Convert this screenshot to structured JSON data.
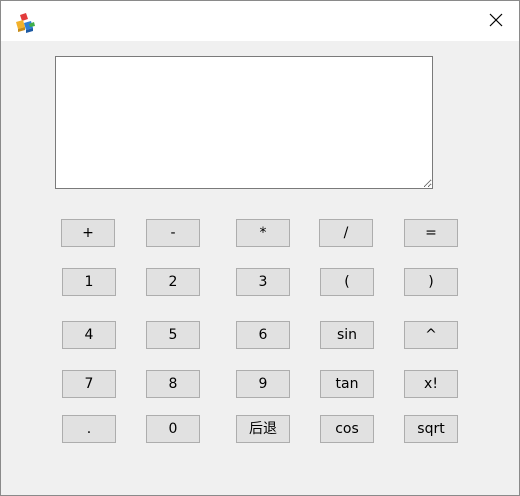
{
  "window": {
    "icon": "app-blocks-icon",
    "close_icon": "close-icon"
  },
  "display": {
    "value": ""
  },
  "buttons": {
    "plus": "+",
    "minus": "-",
    "multiply": "*",
    "divide": "/",
    "equals": "=",
    "d1": "1",
    "d2": "2",
    "d3": "3",
    "lparen": "(",
    "rparen": ")",
    "d4": "4",
    "d5": "5",
    "d6": "6",
    "sin": "sin",
    "power": "^",
    "d7": "7",
    "d8": "8",
    "d9": "9",
    "tan": "tan",
    "factorial": "x!",
    "dot": ".",
    "d0": "0",
    "backspace": "后退",
    "cos": "cos",
    "sqrt": "sqrt"
  },
  "colors": {
    "window_bg": "#f0f0f0",
    "titlebar_bg": "#ffffff",
    "button_bg": "#e1e1e1",
    "button_border": "#adadad"
  }
}
